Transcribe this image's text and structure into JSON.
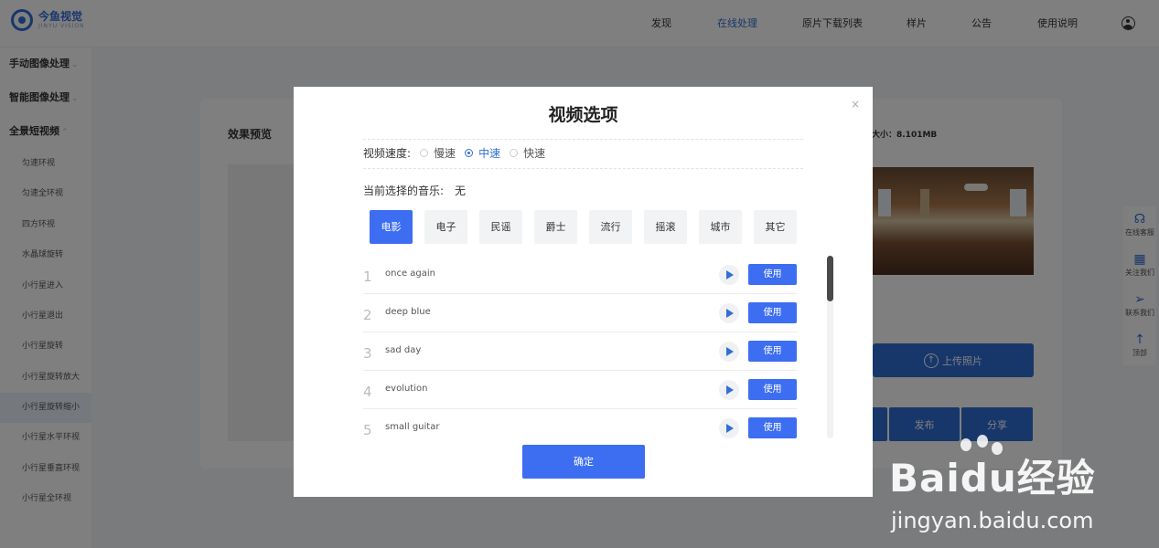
{
  "header": {
    "logo_cn": "今鱼视觉",
    "logo_en": "JINYU VISION",
    "nav": [
      "发现",
      "在线处理",
      "原片下载列表",
      "样片",
      "公告",
      "使用说明"
    ],
    "active_nav": "在线处理"
  },
  "sidebar": {
    "categories": [
      {
        "label": "手动图像处理",
        "chevron": "⌄"
      },
      {
        "label": "智能图像处理",
        "chevron": "⌄"
      },
      {
        "label": "全景短视频",
        "chevron": "⌃"
      }
    ],
    "items": [
      "匀速环视",
      "匀速全环视",
      "四方环视",
      "水晶球旋转",
      "小行星进入",
      "小行星退出",
      "小行星旋转",
      "小行星旋转放大",
      "小行星旋转缩小",
      "小行星水平环视",
      "小行星垂直环视",
      "小行星全环视"
    ],
    "selected": "小行星旋转缩小"
  },
  "main": {
    "preview_title": "效果预览",
    "size_label": "大小：8.101MB",
    "upload_label": "上传照片",
    "actions": [
      "发布",
      "分享"
    ]
  },
  "floatbar": {
    "items": [
      {
        "label": "在线客服",
        "icon": "headset-icon"
      },
      {
        "label": "关注我们",
        "icon": "qrcode-icon"
      },
      {
        "label": "联系我们",
        "icon": "paper-plane-icon"
      },
      {
        "label": "顶部",
        "icon": "arrow-up-icon"
      }
    ]
  },
  "modal": {
    "title": "视频选项",
    "close": "×",
    "speed_label": "视频速度:",
    "speeds": [
      "慢速",
      "中速",
      "快速"
    ],
    "selected_speed": "中速",
    "music_label": "当前选择的音乐:",
    "music_value": "无",
    "categories": [
      "电影",
      "电子",
      "民谣",
      "爵士",
      "流行",
      "摇滚",
      "城市",
      "其它"
    ],
    "selected_category": "电影",
    "songs": [
      {
        "num": "1",
        "name": "once again"
      },
      {
        "num": "2",
        "name": "deep blue"
      },
      {
        "num": "3",
        "name": "sad day"
      },
      {
        "num": "4",
        "name": "evolution"
      },
      {
        "num": "5",
        "name": "small guitar"
      }
    ],
    "use_label": "使用",
    "confirm_label": "确定"
  },
  "watermark": {
    "logo": "Baidu经验",
    "url": "jingyan.baidu.com"
  },
  "colors": {
    "accent": "#3d6ef2",
    "brand": "#2f6fd6",
    "overlay": "rgba(0,0,0,0.5)"
  }
}
